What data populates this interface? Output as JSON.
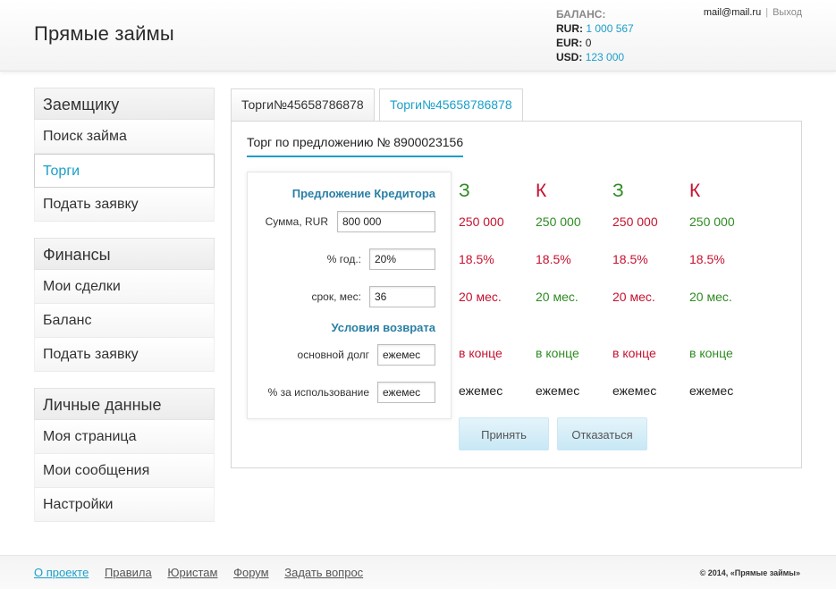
{
  "header": {
    "logo": "Прямые займы",
    "balance": {
      "title": "БАЛАНС:",
      "rows": [
        {
          "currency": "RUR:",
          "value": "1 000 567"
        },
        {
          "currency": "EUR:",
          "value": "0"
        },
        {
          "currency": "USD:",
          "value": "123 000"
        }
      ]
    },
    "user": {
      "email": "mail@mail.ru",
      "separator": "|",
      "logout": "Выход"
    }
  },
  "sidebar": {
    "groups": [
      {
        "title": "Заемщику",
        "items": [
          "Поиск займа",
          "Торги",
          "Подать заявку"
        ]
      },
      {
        "title": "Финансы",
        "items": [
          "Мои сделки",
          "Баланс",
          "Подать заявку"
        ]
      },
      {
        "title": "Личные данные",
        "items": [
          "Моя страница",
          "Мои сообщения",
          "Настройки"
        ]
      }
    ]
  },
  "tabs": [
    "Торги№45658786878",
    "Торги№45658786878"
  ],
  "deal": {
    "title": "Торг по предложению № 8900023156",
    "creditor_title": "Предложение Кредитора",
    "fields": {
      "amount_label": "Сумма, RUR",
      "amount_value": "800 000",
      "rate_label": "% год.:",
      "rate_value": "20%",
      "term_label": "срок, мес:",
      "term_value": "36"
    },
    "return_title": "Условия возврата",
    "return": {
      "principal_label": "основной долг",
      "principal_value": "ежемес",
      "interest_label": "% за использование",
      "interest_value": "ежемес"
    },
    "offers": [
      {
        "letter": "З",
        "amount": "250 000",
        "rate": "18.5%",
        "term": "20 мес.",
        "principal": "в конце",
        "interest": "ежемес"
      },
      {
        "letter": "К",
        "amount": "250 000",
        "rate": "18.5%",
        "term": "20 мес.",
        "principal": "в конце",
        "interest": "ежемес"
      },
      {
        "letter": "З",
        "amount": "250 000",
        "rate": "18.5%",
        "term": "20 мес.",
        "principal": "в конце",
        "interest": "ежемес"
      },
      {
        "letter": "К",
        "amount": "250 000",
        "rate": "18.5%",
        "term": "20 мес.",
        "principal": "в конце",
        "interest": "ежемес"
      }
    ],
    "accept_label": "Принять",
    "decline_label": "Отказаться"
  },
  "footer": {
    "links": [
      "О проекте",
      "Правила",
      "Юристам",
      "Форум",
      "Задать вопрос"
    ],
    "copyright": "© 2014, «Прямые займы»"
  },
  "colors": {
    "accent": "#1a9fc9",
    "green": "#2e8b22",
    "red": "#c4122f"
  }
}
